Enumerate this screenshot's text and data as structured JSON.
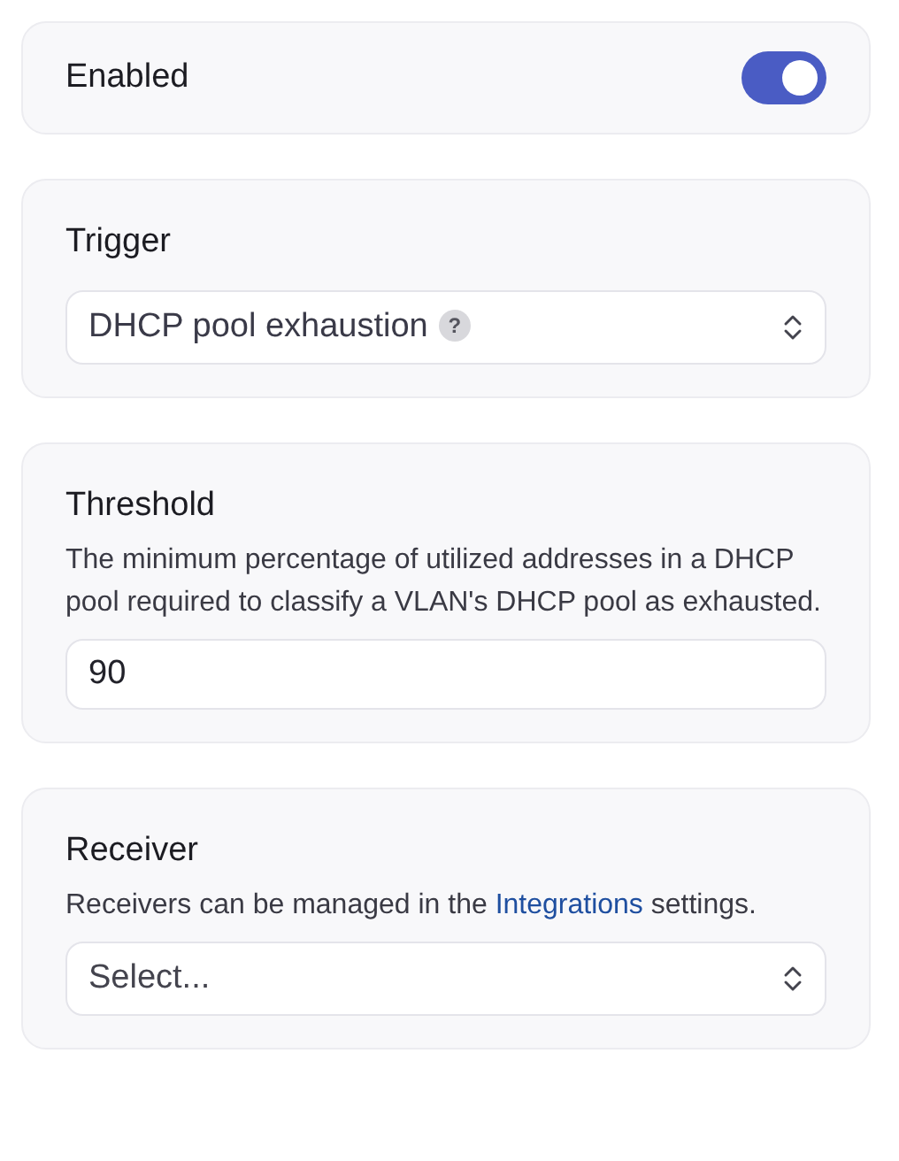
{
  "enabled": {
    "label": "Enabled",
    "on": true
  },
  "trigger": {
    "label": "Trigger",
    "value": "DHCP pool exhaustion",
    "help": "?"
  },
  "threshold": {
    "label": "Threshold",
    "description": "The minimum percentage of utilized addresses in a DHCP pool required to classify a VLAN's DHCP pool as exhausted.",
    "value": "90"
  },
  "receiver": {
    "label": "Receiver",
    "description_before": "Receivers can be managed in the ",
    "link": "Integrations",
    "description_after": " settings.",
    "placeholder": "Select..."
  }
}
